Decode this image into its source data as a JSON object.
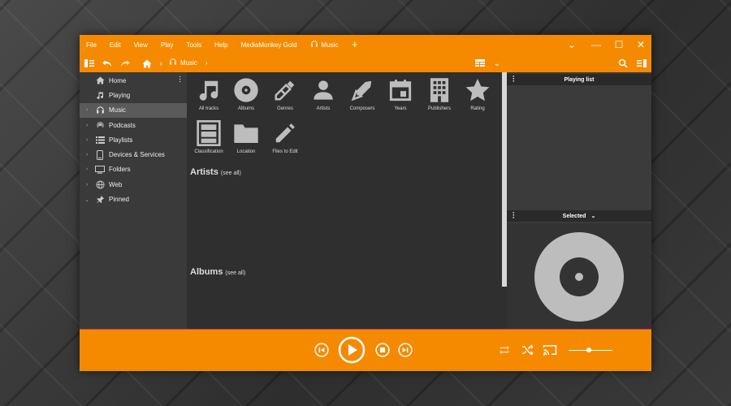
{
  "menu": [
    "File",
    "Edit",
    "View",
    "Play",
    "Tools",
    "Help",
    "MediaMonkey Gold"
  ],
  "tab": {
    "label": "Music",
    "add_label": "+"
  },
  "window_controls": {
    "chevron": "⌄",
    "minimize": "—",
    "maximize": "☐",
    "close": "✕"
  },
  "breadcrumb": {
    "current": "Music"
  },
  "sidebar": {
    "items": [
      {
        "label": "Home",
        "icon": "home-icon",
        "arrow": ""
      },
      {
        "label": "Playing",
        "icon": "music-note-icon",
        "arrow": ""
      },
      {
        "label": "Music",
        "icon": "headphones-icon",
        "arrow": "›"
      },
      {
        "label": "Podcasts",
        "icon": "podcast-icon",
        "arrow": "›"
      },
      {
        "label": "Playlists",
        "icon": "playlist-icon",
        "arrow": "›"
      },
      {
        "label": "Devices & Services",
        "icon": "device-icon",
        "arrow": "›"
      },
      {
        "label": "Folders",
        "icon": "folder-icon",
        "arrow": "›"
      },
      {
        "label": "Web",
        "icon": "globe-icon",
        "arrow": "›"
      },
      {
        "label": "Pinned",
        "icon": "pin-icon",
        "arrow": "⌄"
      }
    ]
  },
  "categories": [
    {
      "label": "All tracks",
      "icon": "music-notes-icon"
    },
    {
      "label": "Albums",
      "icon": "album-icon"
    },
    {
      "label": "Genres",
      "icon": "genres-icon"
    },
    {
      "label": "Artists",
      "icon": "artist-icon"
    },
    {
      "label": "Composers",
      "icon": "pen-nib-icon"
    },
    {
      "label": "Years",
      "icon": "calendar-icon"
    },
    {
      "label": "Publishers",
      "icon": "building-icon"
    },
    {
      "label": "Rating",
      "icon": "star-icon"
    },
    {
      "label": "Classification",
      "icon": "cabinet-icon"
    },
    {
      "label": "Location",
      "icon": "folder-icon"
    },
    {
      "label": "Files to Edit",
      "icon": "pencil-icon"
    }
  ],
  "sections": {
    "artists": {
      "title": "Artists",
      "see_all": "(see all)"
    },
    "albums": {
      "title": "Albums",
      "see_all": "(see all)"
    }
  },
  "right_panel": {
    "playing_list": "Playing list",
    "selected": "Selected",
    "selected_chevron": "⌄"
  },
  "colors": {
    "accent": "#f58a00",
    "panel": "#3a3a3a",
    "main": "#2f2f2f"
  }
}
